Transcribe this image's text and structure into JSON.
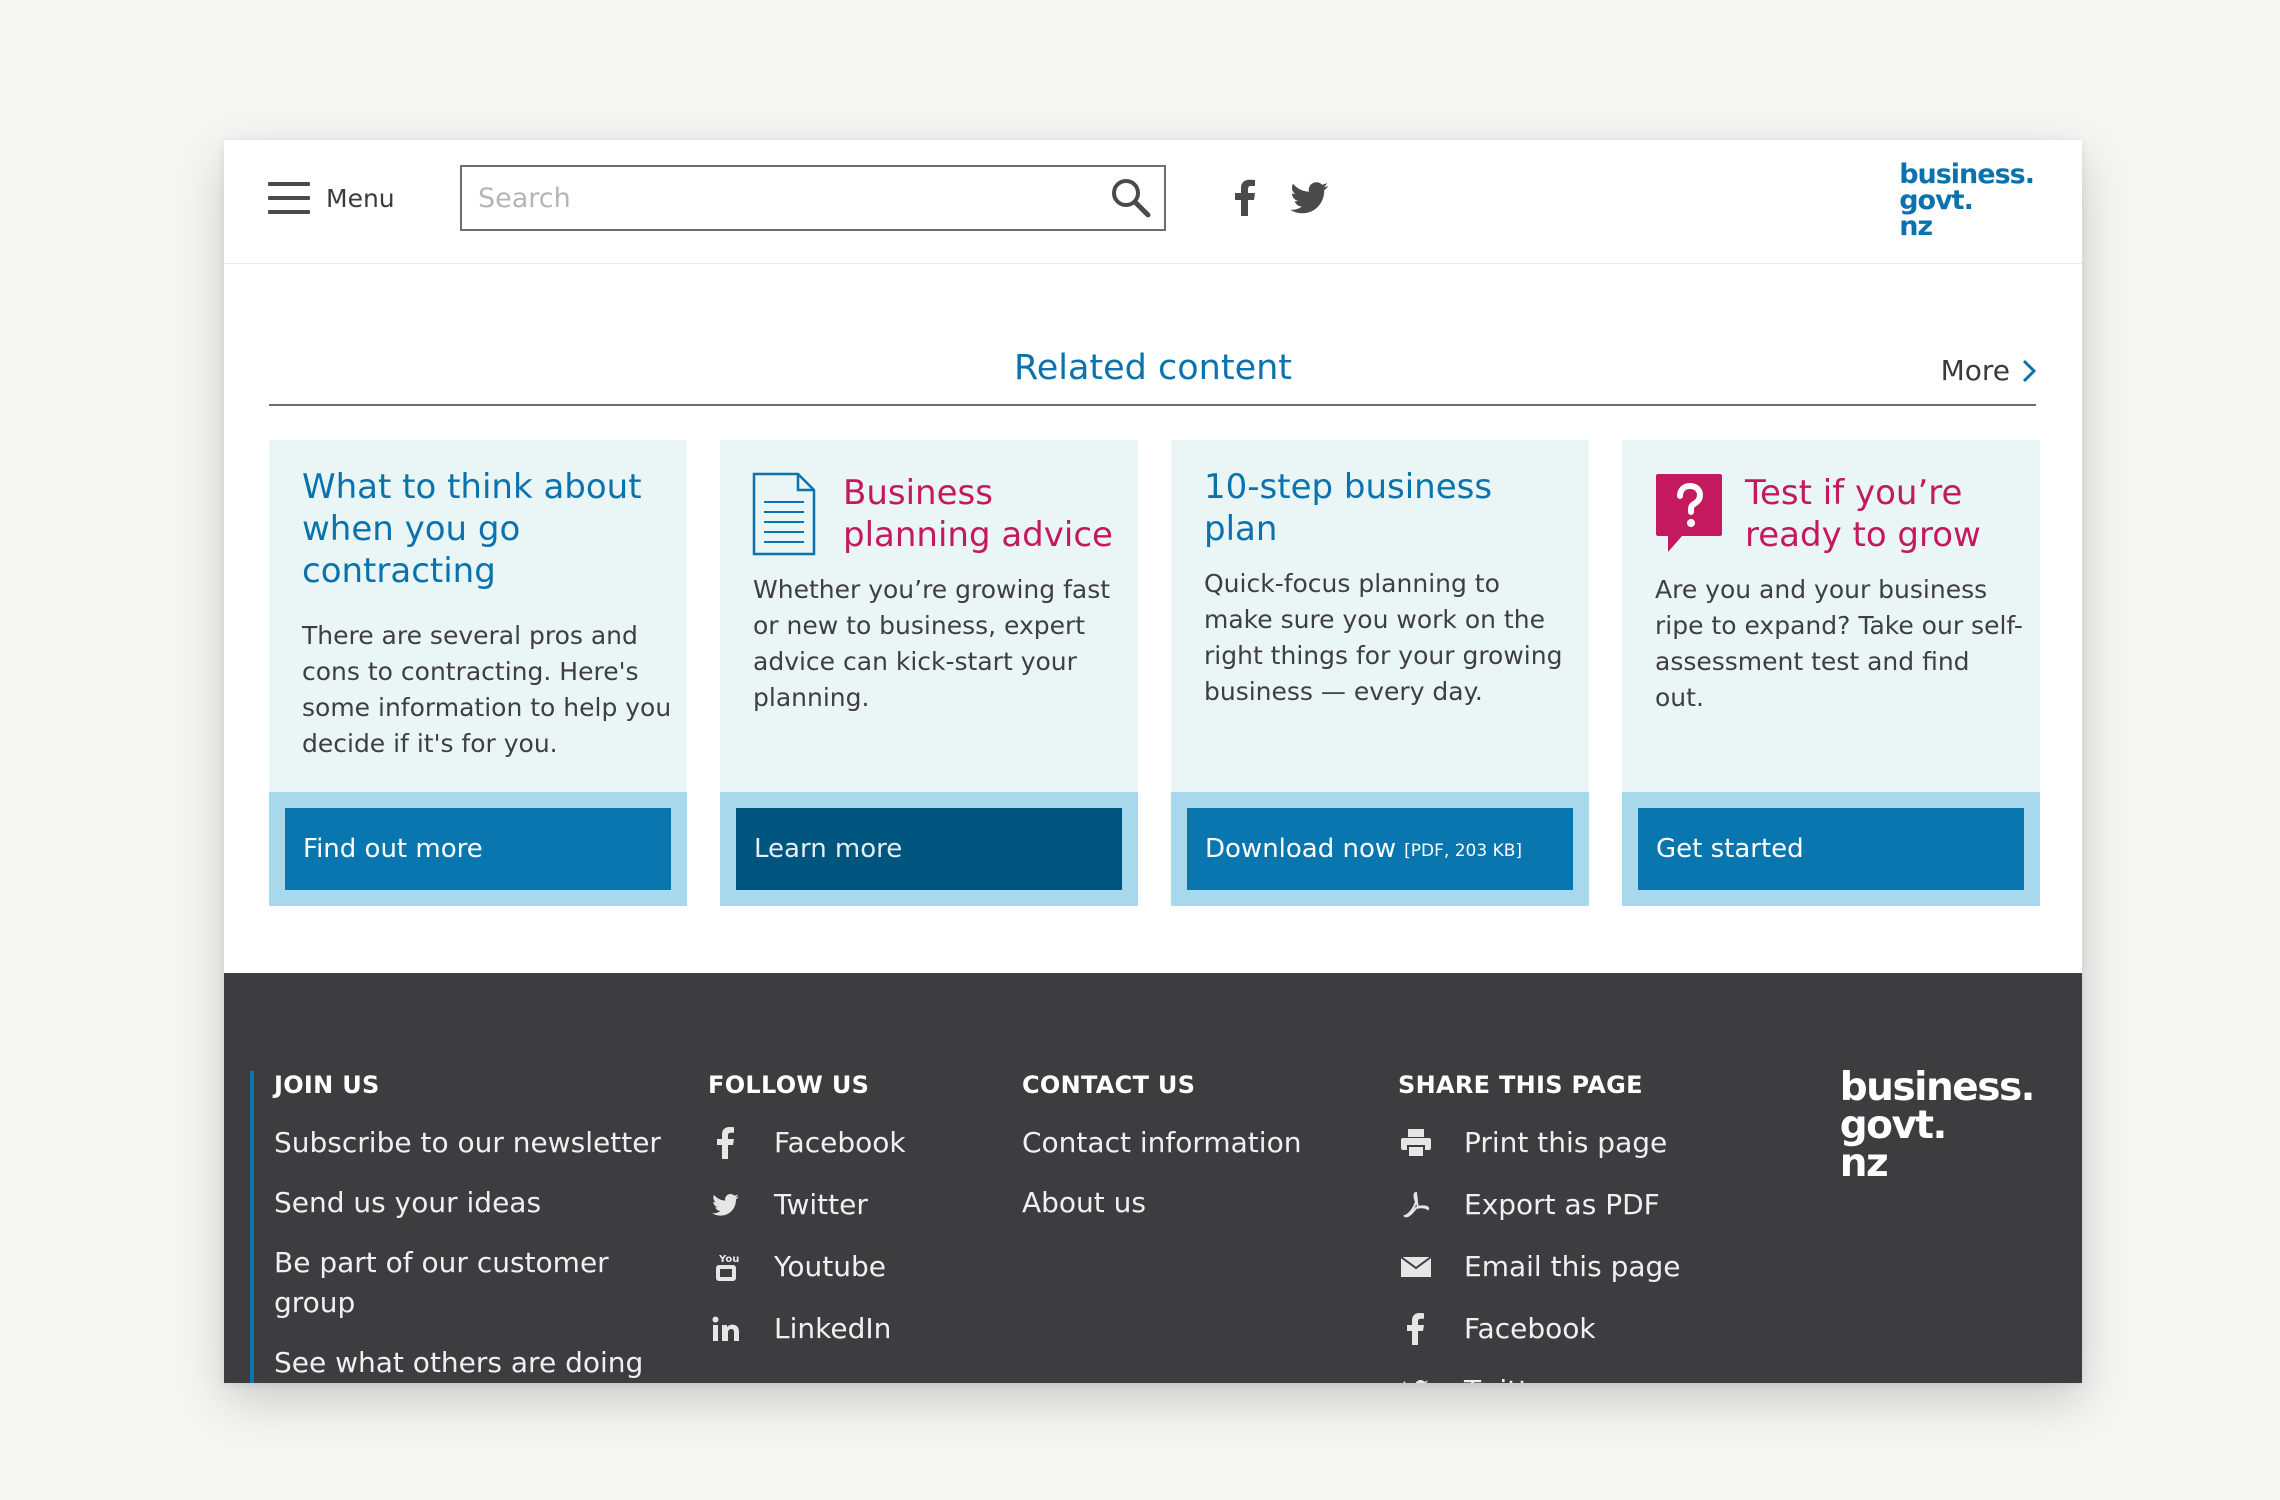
{
  "header": {
    "menu_label": "Menu",
    "search_placeholder": "Search",
    "logo_lines": [
      "business.",
      "govt.",
      "nz"
    ]
  },
  "related": {
    "title": "Related content",
    "more_label": "More"
  },
  "cards": [
    {
      "title": "What to think about when you go contracting",
      "description": "There are several pros and cons to contracting. Here's some information to help you decide if it's for you.",
      "button": "Find out more"
    },
    {
      "title": "Business planning advice",
      "description": "Whether you’re growing fast or new to business, expert advice can kick-start your planning.",
      "button": "Learn more"
    },
    {
      "title": "10-step business plan",
      "description": "Quick-focus planning to make sure you work on the right things for your growing business — every day.",
      "button": "Download now",
      "button_note": "[PDF, 203 KB]"
    },
    {
      "title": "Test if you’re ready to grow",
      "description": "Are you and your business ripe to expand? Take our self-assessment test and find out.",
      "button": "Get started"
    }
  ],
  "footer": {
    "join": {
      "heading": "JOIN US",
      "links": [
        "Subscribe to our newsletter",
        "Send us your ideas",
        "Be part of our customer group",
        "See what others are doing"
      ]
    },
    "follow": {
      "heading": "FOLLOW US",
      "links": [
        "Facebook",
        "Twitter",
        "Youtube",
        "LinkedIn"
      ]
    },
    "contact": {
      "heading": "CONTACT US",
      "links": [
        "Contact information",
        "About us"
      ]
    },
    "share": {
      "heading": "SHARE THIS PAGE",
      "links": [
        "Print this page",
        "Export as PDF",
        "Email this page",
        "Facebook",
        "Twitter"
      ]
    },
    "logo_lines": [
      "business.",
      "govt.",
      "nz"
    ]
  },
  "colors": {
    "brand_blue": "#0a72ac",
    "brand_pink": "#c4195e",
    "card_bg": "#eaf5f5",
    "card_footer_bg": "#a7d8ec",
    "footer_bg": "#3d3d3f"
  }
}
